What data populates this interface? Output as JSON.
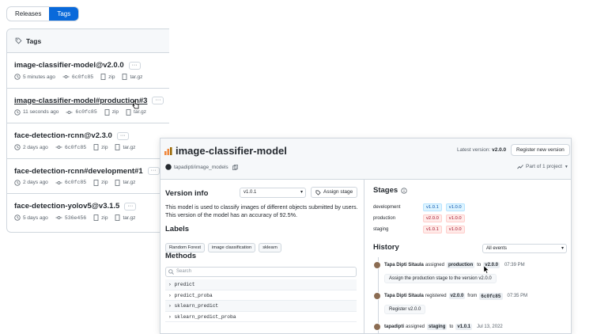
{
  "segmented": {
    "releases": "Releases",
    "tags": "Tags"
  },
  "tags_panel": {
    "header": "Tags",
    "items": [
      {
        "name": "image-classifier-model@v2.0.0",
        "time": "5 minutes ago",
        "commit": "6c0fc85",
        "zip": "zip",
        "tar": "tar.gz"
      },
      {
        "name": "image-classifier-model#production#3",
        "time": "11 seconds ago",
        "commit": "6c0fc85",
        "zip": "zip",
        "tar": "tar.gz"
      },
      {
        "name": "face-detection-rcnn@v2.3.0",
        "time": "2 days ago",
        "commit": "6c0fc85",
        "zip": "zip",
        "tar": "tar.gz"
      },
      {
        "name": "face-detection-rcnn#development#1",
        "time": "2 days ago",
        "commit": "6c0fc85",
        "zip": "zip",
        "tar": "tar.gz"
      },
      {
        "name": "face-detection-yolov5@v3.1.5",
        "time": "5 days ago",
        "commit": "536e456",
        "zip": "zip",
        "tar": "tar.gz"
      }
    ]
  },
  "model": {
    "title": "image-classifier-model",
    "latest_label": "Latest version:",
    "latest_value": "v2.0.0",
    "register_button": "Register new version",
    "repo": "tapadipti/image_models",
    "part_of": "Part of 1 project"
  },
  "version_info": {
    "heading": "Version info",
    "selected_version": "v1.0.1",
    "assign_button": "Assign stage",
    "description": "This model is used to classify images of different objects submitted by users. This version of the model has an accuracy of 92.5%.",
    "labels_heading": "Labels",
    "labels": [
      "Random Forest",
      "image classification",
      "sklearn"
    ],
    "methods_heading": "Methods",
    "search_placeholder": "Search",
    "methods": [
      "predict",
      "predict_proba",
      "sklearn_predict",
      "sklearn_predict_proba"
    ]
  },
  "stages": {
    "heading": "Stages",
    "rows": [
      {
        "name": "development",
        "versions": [
          "v1.0.1",
          "v1.0.0"
        ],
        "color": "blue"
      },
      {
        "name": "production",
        "versions": [
          "v2.0.0",
          "v1.0.0"
        ],
        "color": "red"
      },
      {
        "name": "staging",
        "versions": [
          "v1.0.1",
          "v1.0.0"
        ],
        "color": "red"
      }
    ]
  },
  "history": {
    "heading": "History",
    "filter": "All events",
    "events": [
      {
        "who": "Tapa Dipti Sitaula",
        "verb": "assigned",
        "chip1": "production",
        "mid": "to",
        "chip2": "v2.0.0",
        "time": "07:39 PM",
        "note": "Assign the production stage to the version v2.0.0"
      },
      {
        "who": "Tapa Dipti Sitaula",
        "verb": "registered",
        "chip1": "v2.0.0",
        "mid": "from",
        "chip2": "6c0fc85",
        "time": "07:35 PM",
        "note": "Register v2.0.0"
      },
      {
        "who": "tapadipti",
        "verb": "assigned",
        "chip1": "staging",
        "mid": "to",
        "chip2": "v1.0.1",
        "time": "Jul 13, 2022",
        "note": ""
      }
    ]
  },
  "colors": {
    "accent": "#0969da",
    "border": "#d0d7de"
  }
}
